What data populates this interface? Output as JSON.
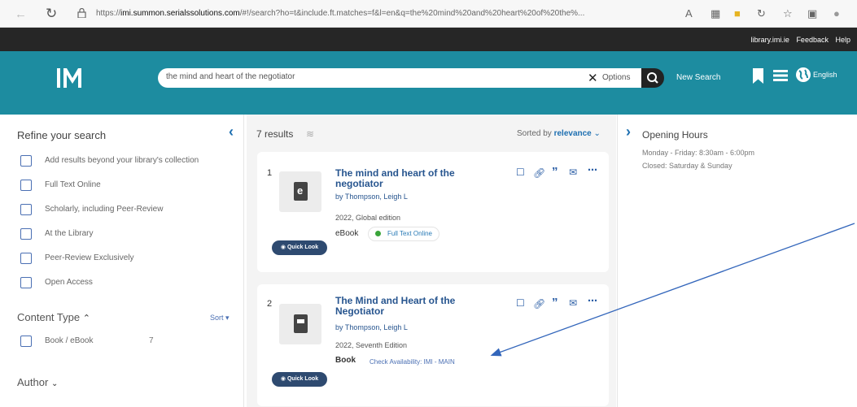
{
  "browser": {
    "url_prefix": "https://",
    "url_domain": "imi.summon.serialssolutions.com",
    "url_rest": "/#!/search?ho=t&include.ft.matches=f&l=en&q=the%20mind%20and%20heart%20of%20the%...",
    "reader_label": "A"
  },
  "topbar": {
    "links": [
      "library.imi.ie",
      "Feedback",
      "Help"
    ]
  },
  "header": {
    "search_value": "the mind and heart of the negotiator",
    "options_label": "Options",
    "new_search_label": "New Search",
    "language_label": "English"
  },
  "sidebar": {
    "title": "Refine your search",
    "filters": [
      "Add results beyond your library's collection",
      "Full Text Online",
      "Scholarly, including Peer-Review",
      "At the Library",
      "Peer-Review Exclusively",
      "Open Access"
    ],
    "content_type_title": "Content Type",
    "sort_label": "Sort",
    "content_types": [
      {
        "label": "Book / eBook",
        "count": "7"
      }
    ],
    "author_title": "Author"
  },
  "results": {
    "count_label": "7 results",
    "sorted_prefix": "Sorted by",
    "sorted_value": "relevance",
    "items": [
      {
        "num": "1",
        "title": "The mind and heart of the negotiator",
        "by": "by Thompson, Leigh L",
        "date": "2022, Global edition",
        "type": "eBook",
        "availability": "Full Text Online",
        "quick_look": "Quick Look",
        "thumb_letter": "e"
      },
      {
        "num": "2",
        "title": "The Mind and Heart of the Negotiator",
        "by": "by Thompson, Leigh L",
        "date": "2022, Seventh Edition",
        "type": "Book",
        "availability": "Check Availability: IMI - MAIN",
        "quick_look": "Quick Look",
        "thumb_letter": ""
      }
    ]
  },
  "right_panel": {
    "title": "Opening Hours",
    "lines": [
      "Monday - Friday: 8:30am - 6:00pm",
      "Closed: Saturday & Sunday"
    ]
  },
  "colors": {
    "header_teal": "#1d8ca0",
    "top_band": "#262626",
    "link_blue": "#27558f",
    "quick_look_bg": "#2e4a70",
    "annotation_arrow": "#3366bb"
  }
}
